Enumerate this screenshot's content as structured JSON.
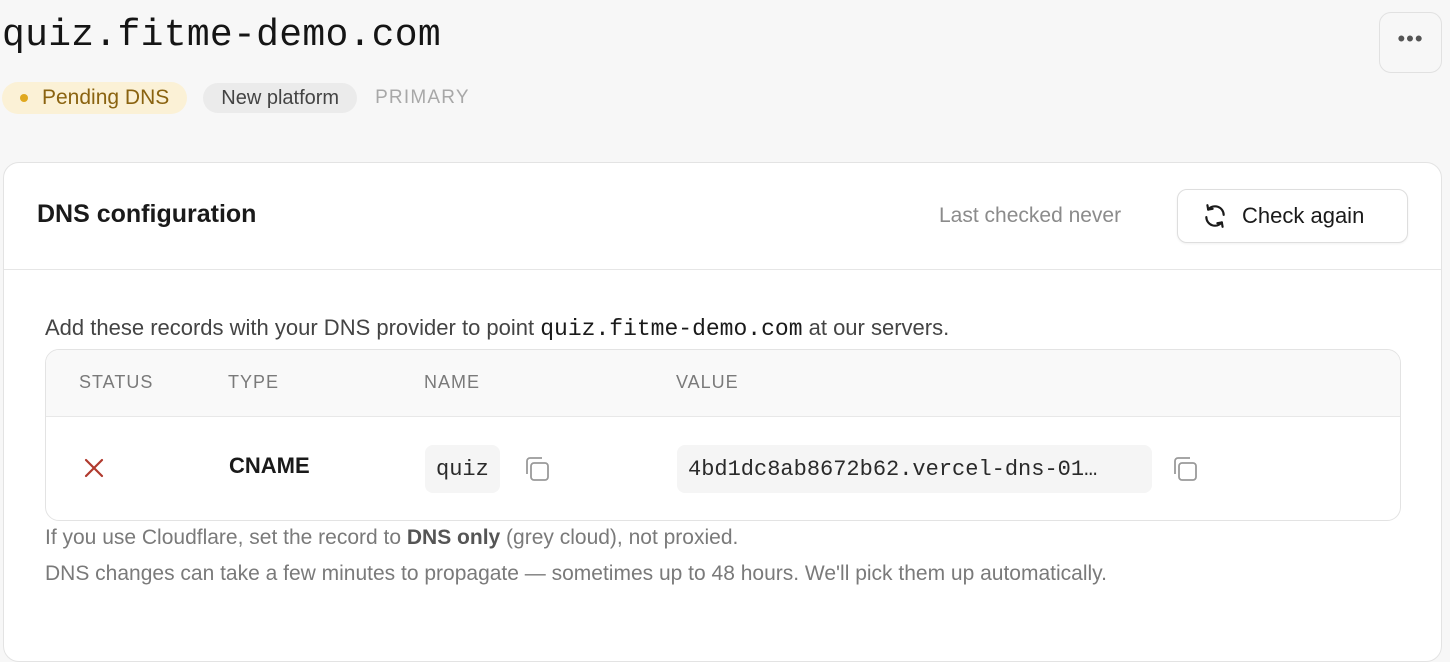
{
  "domain": {
    "name": "quiz.fitme-demo.com",
    "more_label": "•••"
  },
  "badges": {
    "status": "Pending DNS",
    "platform": "New platform",
    "role": "PRIMARY"
  },
  "colors": {
    "pending_bg": "#fbf1d6",
    "pending_text": "#8a6310",
    "pending_dot": "#e0a81f",
    "error_x": "#b03a2e"
  },
  "dns_card": {
    "title": "DNS configuration",
    "last_checked": "Last checked never",
    "check_button": "Check again",
    "intro_before": "Add these records with your DNS provider to point ",
    "intro_domain": "quiz.fitme-demo.com",
    "intro_after": " at our servers.",
    "columns": [
      "STATUS",
      "TYPE",
      "NAME",
      "VALUE"
    ],
    "records": [
      {
        "status": "error",
        "status_icon": "x-icon",
        "type": "CNAME",
        "name": "quiz",
        "value": "4bd1dc8ab8672b62.vercel-dns-01…"
      }
    ],
    "note_cloudflare_before": "If you use Cloudflare, set the record to ",
    "note_cloudflare_bold": "DNS only",
    "note_cloudflare_after": " (grey cloud), not proxied.",
    "note_propagation": "DNS changes can take a few minutes to propagate — sometimes up to 48 hours. We'll pick them up automatically."
  }
}
